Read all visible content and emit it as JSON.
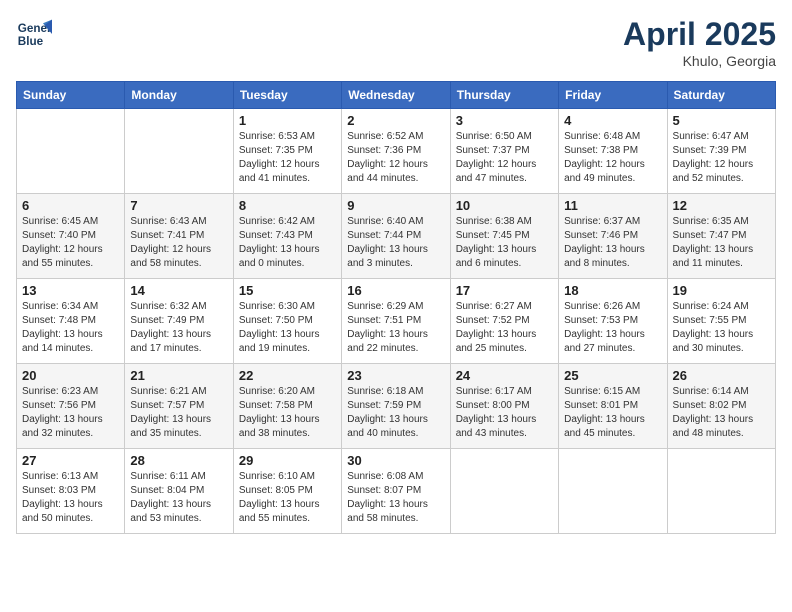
{
  "header": {
    "logo_line1": "General",
    "logo_line2": "Blue",
    "month": "April 2025",
    "location": "Khulo, Georgia"
  },
  "weekdays": [
    "Sunday",
    "Monday",
    "Tuesday",
    "Wednesday",
    "Thursday",
    "Friday",
    "Saturday"
  ],
  "weeks": [
    [
      {
        "day": "",
        "info": ""
      },
      {
        "day": "",
        "info": ""
      },
      {
        "day": "1",
        "info": "Sunrise: 6:53 AM\nSunset: 7:35 PM\nDaylight: 12 hours and 41 minutes."
      },
      {
        "day": "2",
        "info": "Sunrise: 6:52 AM\nSunset: 7:36 PM\nDaylight: 12 hours and 44 minutes."
      },
      {
        "day": "3",
        "info": "Sunrise: 6:50 AM\nSunset: 7:37 PM\nDaylight: 12 hours and 47 minutes."
      },
      {
        "day": "4",
        "info": "Sunrise: 6:48 AM\nSunset: 7:38 PM\nDaylight: 12 hours and 49 minutes."
      },
      {
        "day": "5",
        "info": "Sunrise: 6:47 AM\nSunset: 7:39 PM\nDaylight: 12 hours and 52 minutes."
      }
    ],
    [
      {
        "day": "6",
        "info": "Sunrise: 6:45 AM\nSunset: 7:40 PM\nDaylight: 12 hours and 55 minutes."
      },
      {
        "day": "7",
        "info": "Sunrise: 6:43 AM\nSunset: 7:41 PM\nDaylight: 12 hours and 58 minutes."
      },
      {
        "day": "8",
        "info": "Sunrise: 6:42 AM\nSunset: 7:43 PM\nDaylight: 13 hours and 0 minutes."
      },
      {
        "day": "9",
        "info": "Sunrise: 6:40 AM\nSunset: 7:44 PM\nDaylight: 13 hours and 3 minutes."
      },
      {
        "day": "10",
        "info": "Sunrise: 6:38 AM\nSunset: 7:45 PM\nDaylight: 13 hours and 6 minutes."
      },
      {
        "day": "11",
        "info": "Sunrise: 6:37 AM\nSunset: 7:46 PM\nDaylight: 13 hours and 8 minutes."
      },
      {
        "day": "12",
        "info": "Sunrise: 6:35 AM\nSunset: 7:47 PM\nDaylight: 13 hours and 11 minutes."
      }
    ],
    [
      {
        "day": "13",
        "info": "Sunrise: 6:34 AM\nSunset: 7:48 PM\nDaylight: 13 hours and 14 minutes."
      },
      {
        "day": "14",
        "info": "Sunrise: 6:32 AM\nSunset: 7:49 PM\nDaylight: 13 hours and 17 minutes."
      },
      {
        "day": "15",
        "info": "Sunrise: 6:30 AM\nSunset: 7:50 PM\nDaylight: 13 hours and 19 minutes."
      },
      {
        "day": "16",
        "info": "Sunrise: 6:29 AM\nSunset: 7:51 PM\nDaylight: 13 hours and 22 minutes."
      },
      {
        "day": "17",
        "info": "Sunrise: 6:27 AM\nSunset: 7:52 PM\nDaylight: 13 hours and 25 minutes."
      },
      {
        "day": "18",
        "info": "Sunrise: 6:26 AM\nSunset: 7:53 PM\nDaylight: 13 hours and 27 minutes."
      },
      {
        "day": "19",
        "info": "Sunrise: 6:24 AM\nSunset: 7:55 PM\nDaylight: 13 hours and 30 minutes."
      }
    ],
    [
      {
        "day": "20",
        "info": "Sunrise: 6:23 AM\nSunset: 7:56 PM\nDaylight: 13 hours and 32 minutes."
      },
      {
        "day": "21",
        "info": "Sunrise: 6:21 AM\nSunset: 7:57 PM\nDaylight: 13 hours and 35 minutes."
      },
      {
        "day": "22",
        "info": "Sunrise: 6:20 AM\nSunset: 7:58 PM\nDaylight: 13 hours and 38 minutes."
      },
      {
        "day": "23",
        "info": "Sunrise: 6:18 AM\nSunset: 7:59 PM\nDaylight: 13 hours and 40 minutes."
      },
      {
        "day": "24",
        "info": "Sunrise: 6:17 AM\nSunset: 8:00 PM\nDaylight: 13 hours and 43 minutes."
      },
      {
        "day": "25",
        "info": "Sunrise: 6:15 AM\nSunset: 8:01 PM\nDaylight: 13 hours and 45 minutes."
      },
      {
        "day": "26",
        "info": "Sunrise: 6:14 AM\nSunset: 8:02 PM\nDaylight: 13 hours and 48 minutes."
      }
    ],
    [
      {
        "day": "27",
        "info": "Sunrise: 6:13 AM\nSunset: 8:03 PM\nDaylight: 13 hours and 50 minutes."
      },
      {
        "day": "28",
        "info": "Sunrise: 6:11 AM\nSunset: 8:04 PM\nDaylight: 13 hours and 53 minutes."
      },
      {
        "day": "29",
        "info": "Sunrise: 6:10 AM\nSunset: 8:05 PM\nDaylight: 13 hours and 55 minutes."
      },
      {
        "day": "30",
        "info": "Sunrise: 6:08 AM\nSunset: 8:07 PM\nDaylight: 13 hours and 58 minutes."
      },
      {
        "day": "",
        "info": ""
      },
      {
        "day": "",
        "info": ""
      },
      {
        "day": "",
        "info": ""
      }
    ]
  ]
}
